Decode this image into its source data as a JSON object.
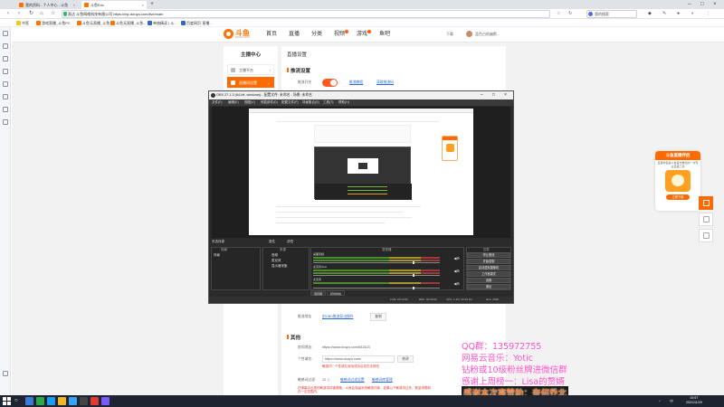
{
  "browser": {
    "tabs": [
      {
        "label": "我的资料 - 个人中心 - 斗鱼",
        "color": "#ff7200"
      },
      {
        "label": "斗鱼Eric",
        "color": "#ff7200"
      }
    ],
    "new_tab": "+",
    "url": "直达 斗鱼网络科技有限公司 https://mp.douyu.com/live/main",
    "search_placeholder": "我的搜索",
    "right_labels": [
      "☆",
      "↻",
      "✎",
      "⋮"
    ],
    "bookmarks": [
      {
        "label": "书签",
        "color": "#f5c518"
      },
      {
        "label": "游戏直播_斗鱼PC",
        "color": "#ff7200"
      },
      {
        "label": "斗鱼无直播_斗鱼...",
        "color": "#ff7200"
      },
      {
        "label": "斗鱼无直播_斗鱼...",
        "color": "#ff7200"
      },
      {
        "label": "单曲精读 | 斗...",
        "color": "#3366cc"
      },
      {
        "label": "百度网页·直播...",
        "color": "#3366cc"
      }
    ]
  },
  "site": {
    "logo_text": "斗鱼",
    "logo_sub": "DOUYU.COM",
    "nav": [
      "首页",
      "直播",
      "分类",
      "视频",
      "游戏",
      "鱼吧"
    ],
    "nav_badges": [
      false,
      false,
      false,
      true,
      true,
      false
    ],
    "header_right": [
      "下载",
      "蓝色白纸幽默..."
    ],
    "left_menu": {
      "title": "主播中心",
      "items": [
        {
          "label": "主播平台",
          "active": false
        },
        {
          "label": "直播间设置",
          "active": true
        }
      ]
    },
    "main": {
      "title": "直播设置",
      "section1": "推流设置",
      "row1_label": "推流开关",
      "link1": "推流教程",
      "link2": "获取推流码",
      "row_bottom_label": "推流地址",
      "row_bottom_link": "由OBS推流导出操作",
      "row_bottom_btn": "复制",
      "section2": "其他",
      "other_rows": [
        {
          "label": "房间地址:",
          "value": "https://www.douyu.com/642423"
        },
        {
          "label": "个性域名:",
          "value": "https://www.douyu.com/",
          "btn": "修改"
        },
        {
          "label": "敏感词过滤:",
          "value": "12 :)",
          "link": "敏感词过滤设置",
          "link2": "敏感词库管理"
        }
      ],
      "red_note1": "敏感词：个性域名添加成功后将无法修改",
      "red_note2": "在弹幕中出现的敏感词将被屏蔽，斗鱼会保留系统敏感词库，如果以下敏感词过多，数量请限制在一定范围内。"
    },
    "promo": {
      "title": "斗鱼直播伴侣",
      "desc": "直播伴侣是斗鱼官方推出的一款专业直播工具",
      "button": "立即下载"
    }
  },
  "obs": {
    "title": "OBS 27.1.3 (64-bit, windows) - 配置文件: 未命名 - 场景: 未命名",
    "menu": [
      "文件(F)",
      "编辑(E)",
      "视图(V)",
      "停靠部件(D)",
      "配置文件(P)",
      "场景集合(S)",
      "工具(T)",
      "帮助(H)"
    ],
    "no_source": "未选择源",
    "tabs_labels": [
      "属性",
      "滤镜"
    ],
    "panels": {
      "scenes": "场景",
      "sources": "来源",
      "mixer": "混音器",
      "controls": "控件"
    },
    "scene_items": [
      "场景"
    ],
    "source_items": [
      "音频",
      "麦克风",
      "显示器采集"
    ],
    "mixer_rows": [
      {
        "name": "桌面音频",
        "db": "0.0 dB"
      },
      {
        "name": "麦克风/Aux",
        "db": "0.0 dB"
      },
      {
        "name": "麦克风",
        "db": "0.0 dB"
      }
    ],
    "mixer_tabs": [
      "混音器",
      "转场特效"
    ],
    "controls": [
      "停止推流",
      "开始录制",
      "启动虚拟摄像机",
      "工作室模式",
      "设置",
      "退出"
    ],
    "status": [
      "LIVE: 00:14:53",
      "REC: 00:00:00",
      "CPU: 1.4%, 60.00 fps",
      "kb/s: 2548"
    ]
  },
  "overlay": {
    "lines": [
      "QQ群：135972755",
      "网易云音乐：Yotic",
      "钻粉或10级粉丝牌进微信群",
      "感谢上周榜一：Lisa的赘婿",
      "感谢本次赛赞助：奈何乔北"
    ]
  },
  "taskbar": {
    "clock_time": "19:57",
    "clock_date": "2021/11/29",
    "tray": [
      "^",
      "中"
    ]
  }
}
